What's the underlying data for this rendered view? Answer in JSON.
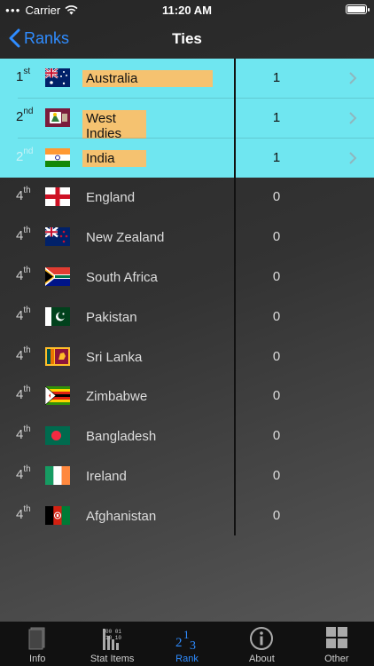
{
  "status": {
    "carrier": "Carrier",
    "time": "11:20 AM"
  },
  "nav": {
    "back_label": "Ranks",
    "title": "Ties"
  },
  "rows": [
    {
      "rank_num": "1",
      "rank_suffix": "st",
      "country": "Australia",
      "value": "1",
      "highlighted": true,
      "flag": "australia-flag-icon"
    },
    {
      "rank_num": "2",
      "rank_suffix": "nd",
      "country": "West Indies",
      "value": "1",
      "highlighted": true,
      "flag": "west-indies-flag-icon"
    },
    {
      "rank_num": "2",
      "rank_suffix": "nd",
      "country": "India",
      "value": "1",
      "highlighted": true,
      "flag": "india-flag-icon"
    },
    {
      "rank_num": "4",
      "rank_suffix": "th",
      "country": "England",
      "value": "0",
      "highlighted": false,
      "flag": "england-flag-icon"
    },
    {
      "rank_num": "4",
      "rank_suffix": "th",
      "country": "New Zealand",
      "value": "0",
      "highlighted": false,
      "flag": "new-zealand-flag-icon"
    },
    {
      "rank_num": "4",
      "rank_suffix": "th",
      "country": "South Africa",
      "value": "0",
      "highlighted": false,
      "flag": "south-africa-flag-icon"
    },
    {
      "rank_num": "4",
      "rank_suffix": "th",
      "country": "Pakistan",
      "value": "0",
      "highlighted": false,
      "flag": "pakistan-flag-icon"
    },
    {
      "rank_num": "4",
      "rank_suffix": "th",
      "country": "Sri Lanka",
      "value": "0",
      "highlighted": false,
      "flag": "sri-lanka-flag-icon"
    },
    {
      "rank_num": "4",
      "rank_suffix": "th",
      "country": "Zimbabwe",
      "value": "0",
      "highlighted": false,
      "flag": "zimbabwe-flag-icon"
    },
    {
      "rank_num": "4",
      "rank_suffix": "th",
      "country": "Bangladesh",
      "value": "0",
      "highlighted": false,
      "flag": "bangladesh-flag-icon"
    },
    {
      "rank_num": "4",
      "rank_suffix": "th",
      "country": "Ireland",
      "value": "0",
      "highlighted": false,
      "flag": "ireland-flag-icon"
    },
    {
      "rank_num": "4",
      "rank_suffix": "th",
      "country": "Afghanistan",
      "value": "0",
      "highlighted": false,
      "flag": "afghanistan-flag-icon"
    }
  ],
  "tabs": [
    {
      "label": "Info",
      "icon": "book-icon",
      "active": false
    },
    {
      "label": "Stat Items",
      "icon": "stats-icon",
      "active": false
    },
    {
      "label": "Rank",
      "icon": "rank-icon",
      "active": true
    },
    {
      "label": "About",
      "icon": "info-icon",
      "active": false
    },
    {
      "label": "Other",
      "icon": "grid-icon",
      "active": false
    }
  ],
  "colors": {
    "accent": "#2f8cff",
    "highlight_row": "#6fe6f0",
    "highlight_label": "#f5c270"
  }
}
